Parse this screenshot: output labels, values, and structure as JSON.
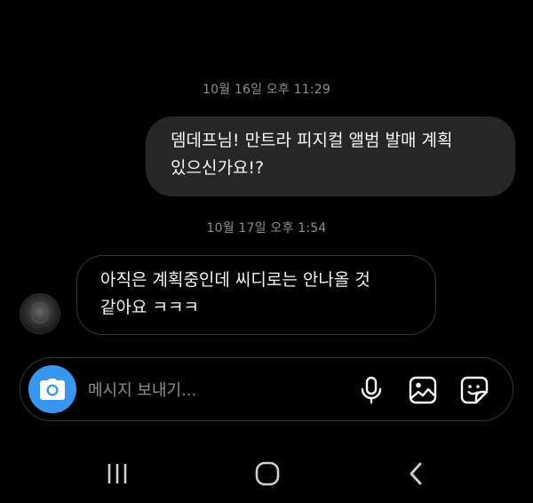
{
  "conversation": {
    "timestamp_1": "10월 16일 오후 11:29",
    "outgoing_message_line1": "뎀데프님! 만트라 피지컬 앨범 발매 계획",
    "outgoing_message_line2": "있으신가요!?",
    "timestamp_2": "10월 17일 오후 1:54",
    "incoming_message_line1": "아직은 계획중인데 씨디로는 안나올 것",
    "incoming_message_line2": "같아요 ㅋㅋㅋ"
  },
  "composer": {
    "placeholder": "메시지 보내기...",
    "value": ""
  },
  "icons": {
    "camera": "camera-icon",
    "mic": "microphone-icon",
    "gallery": "gallery-icon",
    "sticker": "sticker-icon",
    "nav_recent": "recent-apps-icon",
    "nav_home": "home-icon",
    "nav_back": "back-icon"
  },
  "colors": {
    "background": "#000000",
    "outgoing_bubble": "#262626",
    "incoming_bubble_border": "#363636",
    "accent_camera": "#3797f0",
    "timestamp_text": "#8e8e8e"
  }
}
